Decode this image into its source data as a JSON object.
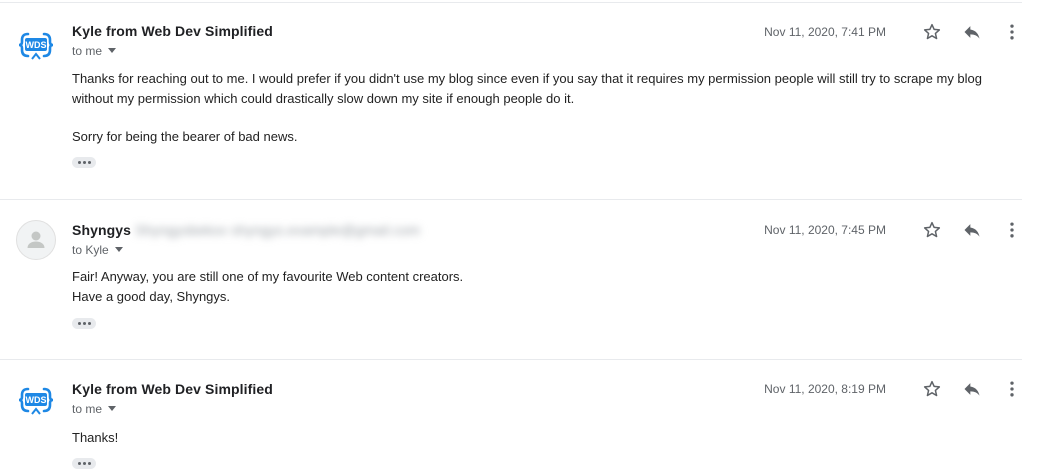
{
  "messages": [
    {
      "sender": "Kyle from Web Dev Simplified",
      "recipient": "to me",
      "date": "Nov 11, 2020, 7:41 PM",
      "avatar": "wds-logo",
      "paragraphs": [
        "Thanks for reaching out to me. I would prefer if you didn't use my blog since even if you say that it requires my permission people will still try to scrape my blog without my permission which could drastically slow down my site if enough people do it.",
        "Sorry for being the bearer of bad news."
      ]
    },
    {
      "sender": "Shyngys",
      "sender_hidden": "Shyngys  shyngys.example@gmail.com",
      "recipient": "to Kyle",
      "date": "Nov 11, 2020, 7:45 PM",
      "avatar": "person-icon",
      "lines": [
        "Fair! Anyway, you are still one of my favourite Web content creators.",
        "Have a good day, Shyngys."
      ]
    },
    {
      "sender": "Kyle from Web Dev Simplified",
      "recipient": "to me",
      "date": "Nov 11, 2020, 8:19 PM",
      "avatar": "wds-logo",
      "lines": [
        "Thanks!"
      ]
    }
  ],
  "colors": {
    "wds_blue": "#1e88e5",
    "text": "#202124",
    "muted": "#5f6368",
    "divider": "#e8eaed"
  }
}
